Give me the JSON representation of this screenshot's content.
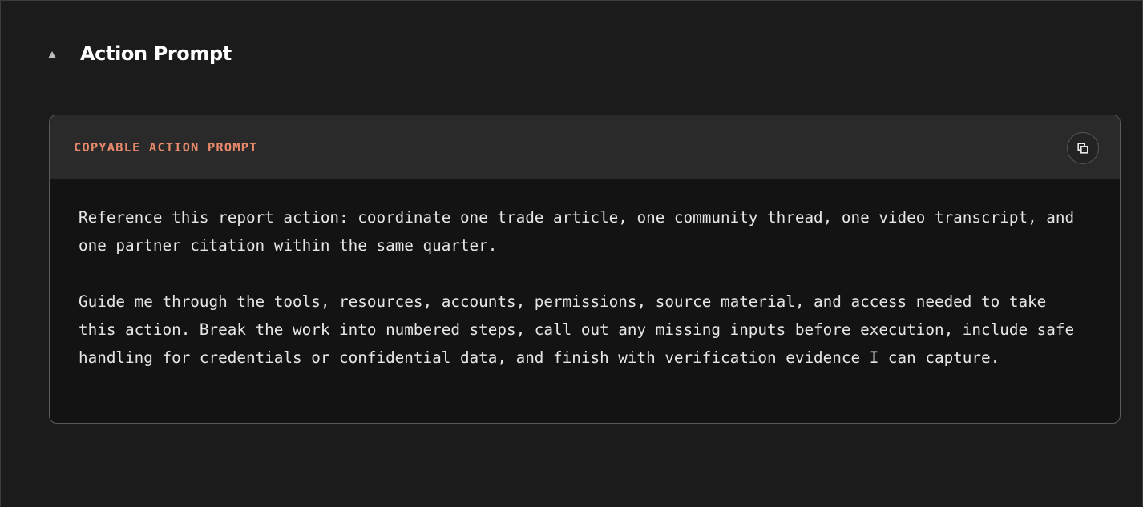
{
  "section": {
    "title": "Action Prompt",
    "caret_icon": "caret-up-icon"
  },
  "card": {
    "label": "COPYABLE ACTION PROMPT",
    "copy_icon": "copy-icon",
    "paragraphs": [
      "Reference this report action: coordinate one trade article, one community thread, one video transcript, and one partner citation within the same quarter.",
      "Guide me through the tools, resources, accounts, permissions, source material, and access needed to take this action. Break the work into numbered steps, call out any missing inputs before execution, include safe handling for credentials or confidential data, and finish with verification evidence I can capture."
    ]
  },
  "colors": {
    "background": "#1b1b1b",
    "card_header": "#2a2a2a",
    "card_body": "#131313",
    "accent": "#e9896b",
    "text": "#e6e6e6",
    "title": "#ffffff"
  }
}
